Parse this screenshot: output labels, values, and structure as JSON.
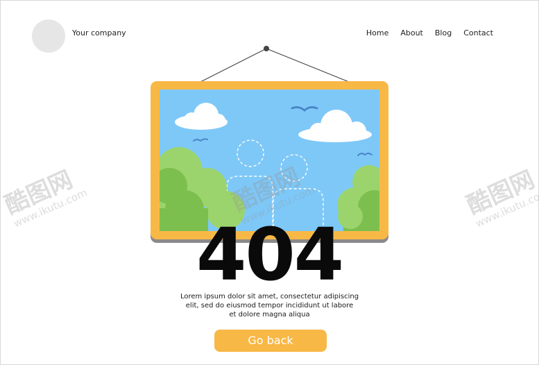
{
  "header": {
    "company": "Your company",
    "nav": [
      "Home",
      "About",
      "Blog",
      "Contact"
    ]
  },
  "error": {
    "code": "404",
    "description_lines": [
      "Lorem ipsum dolor sit amet, consectetur adipiscing",
      "elit, sed do eiusmod tempor incididunt ut labore",
      "et dolore magna aliqua"
    ],
    "button_label": "Go back"
  },
  "watermark": {
    "brand": "酷图网",
    "url": "www.ikutu.com"
  },
  "colors": {
    "frame": "#f8b846",
    "sky": "#7ec8f8",
    "bush_light": "#9bd46c",
    "bush_dark": "#7dbf4e",
    "button": "#f8b846",
    "birds": "#4a86c8"
  }
}
